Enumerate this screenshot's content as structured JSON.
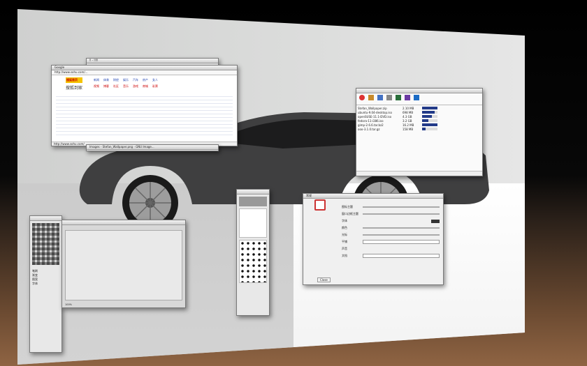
{
  "browser_back": {
    "title": "ǃǃ - ǃǃǃǃǃ"
  },
  "browser": {
    "url": "http://www.sohu.com/...",
    "tab_label": "Google",
    "logo_text": "搜狐首页",
    "site_name": "搜狐到家",
    "status_url": "http://www.sohu.com/",
    "news_left": [
      "新闻",
      "体育",
      "财经",
      "娱乐",
      "汽车",
      "房产",
      "女人"
    ],
    "news_right": [
      "视频",
      "博客",
      "社区",
      "音乐",
      "游戏",
      "商城",
      "彩票"
    ]
  },
  "wallpaper_dialog": {
    "title": "Images - Stefan_Wallpaper.png - GNU Image..."
  },
  "client": {
    "toolbar_labels": [
      "新建任务",
      "开始",
      "暂停",
      "删除",
      "打开",
      "目录",
      "选项"
    ],
    "rows": [
      {
        "name": "Stefan_Wallpaper.zip",
        "size": "2.10 MB",
        "progress": 1.0
      },
      {
        "name": "ubuntu-9.04-desktop.iso",
        "size": "698 MB",
        "progress": 0.82
      },
      {
        "name": "openSUSE-11.1-DVD.iso",
        "size": "4.3 GB",
        "progress": 0.64
      },
      {
        "name": "fedora-11-i386.iso",
        "size": "3.2 GB",
        "progress": 0.41
      },
      {
        "name": "gimp-2.6.6.tar.bz2",
        "size": "16.2 MB",
        "progress": 1.0
      },
      {
        "name": "ooo-3.1.0.tar.gz",
        "size": "158 MB",
        "progress": 0.23
      }
    ]
  },
  "settings": {
    "tab": "常规",
    "fields": [
      "图标主题",
      "窗口边框主题",
      "字体",
      "颜色",
      "光标",
      "平铺",
      "声音",
      "文档"
    ],
    "close_label": "Close"
  },
  "toolbox": {
    "labels": [
      "笔刷",
      "渐变",
      "图案",
      "字体"
    ]
  },
  "gimp_image": {
    "status": "100%"
  }
}
